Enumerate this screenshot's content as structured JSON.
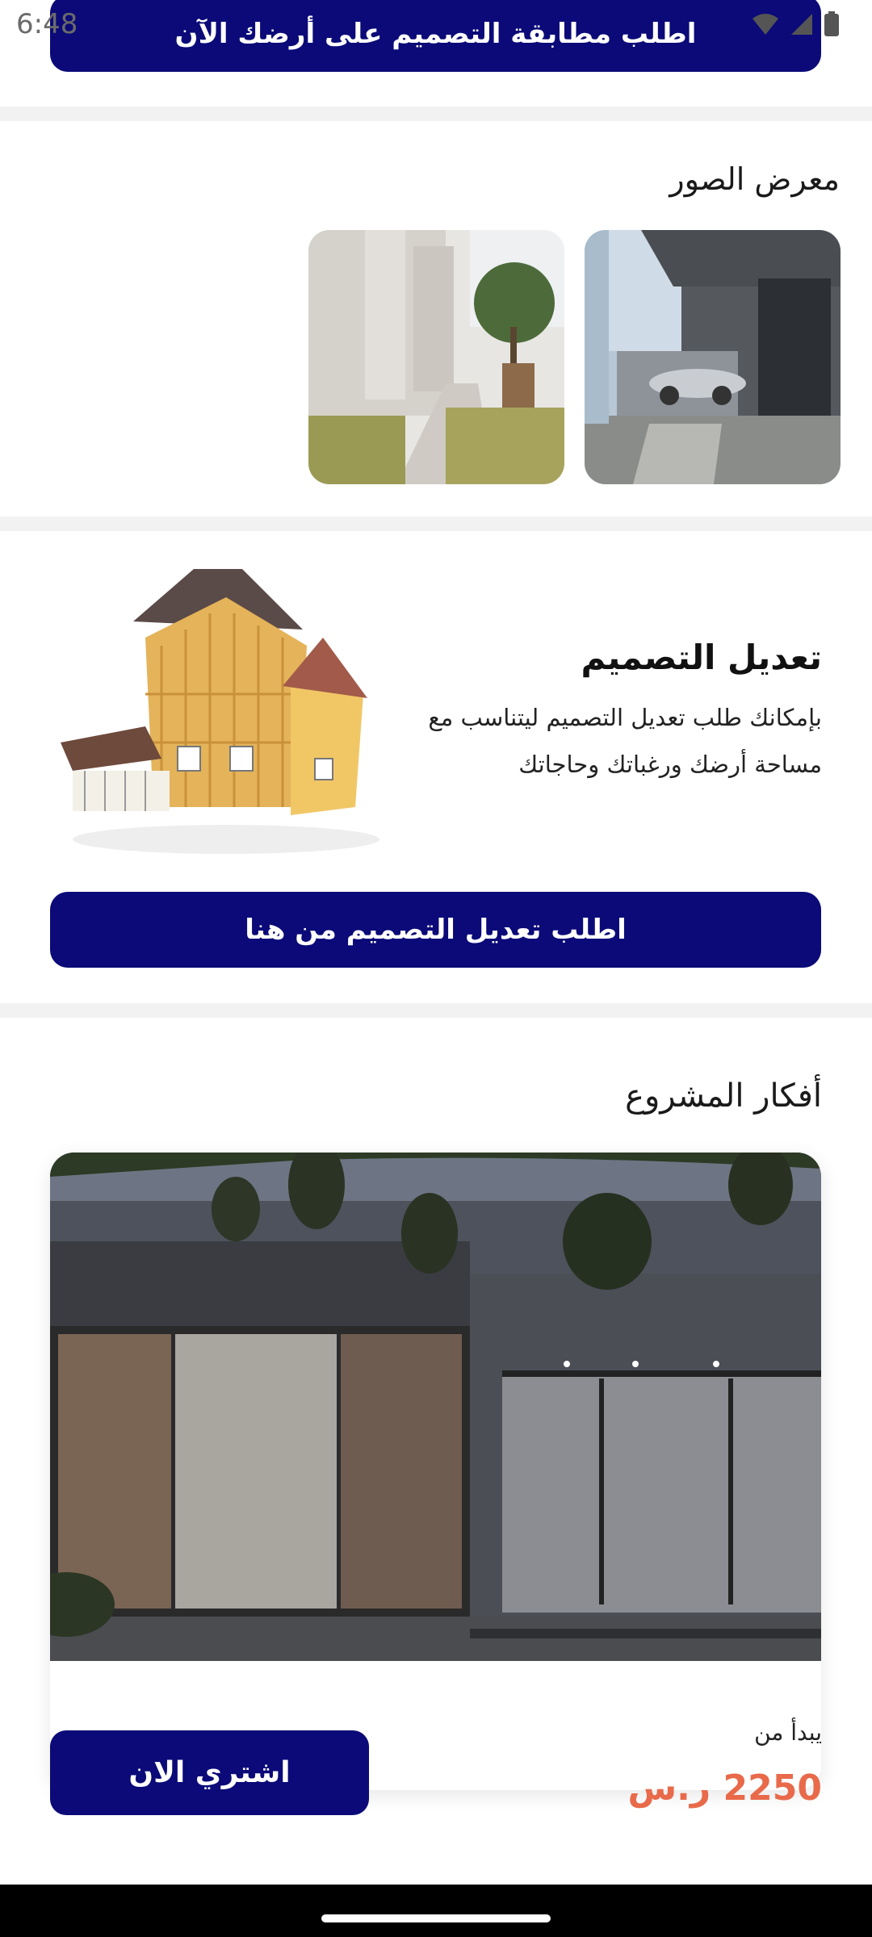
{
  "status": {
    "time": "6:48"
  },
  "top_button": {
    "label": "اطلب مطابقة التصميم على أرضك الآن"
  },
  "gallery": {
    "title": "معرض الصور"
  },
  "modify": {
    "title": "تعديل التصميم",
    "description": "بإمكانك طلب تعديل التصميم ليتناسب مع مساحة أرضك ورغباتك وحاجاتك",
    "button_label": "اطلب تعديل التصميم من هنا"
  },
  "project": {
    "title": "أفكار المشروع",
    "starts_from_label": "يبدأ من",
    "price": "2250 ر.س",
    "buy_label": "اشتري الان"
  },
  "colors": {
    "primary": "#0b0a78",
    "price": "#e86a4a",
    "divider": "#f2f2f2"
  }
}
